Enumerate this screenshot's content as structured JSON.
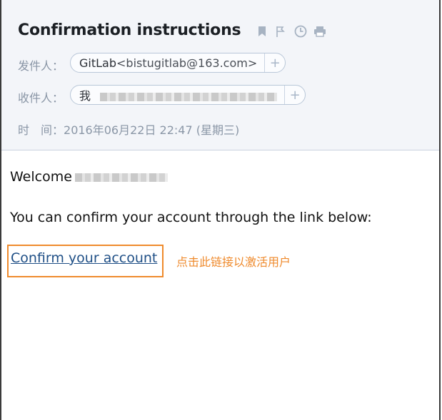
{
  "email": {
    "subject": "Confirmation instructions",
    "from_label": "发件人：",
    "from_name": "GitLab",
    "from_address": "<bistugitlab@163.com>",
    "to_label": "收件人：",
    "to_name": "我",
    "time_label": "时　间：",
    "time_value": "2016年06月22日 22:47 (星期三)",
    "plus": "+"
  },
  "body": {
    "greeting": "Welcome",
    "line1": "You can confirm your account through the link below:",
    "link_text": "Confirm your account",
    "annotation": "点击此链接以激活用户"
  },
  "icons": [
    "bookmark-icon",
    "flag-icon",
    "clock-icon",
    "print-icon"
  ],
  "colors": {
    "annotation": "#ef8a2c",
    "link": "#1f4f86"
  }
}
